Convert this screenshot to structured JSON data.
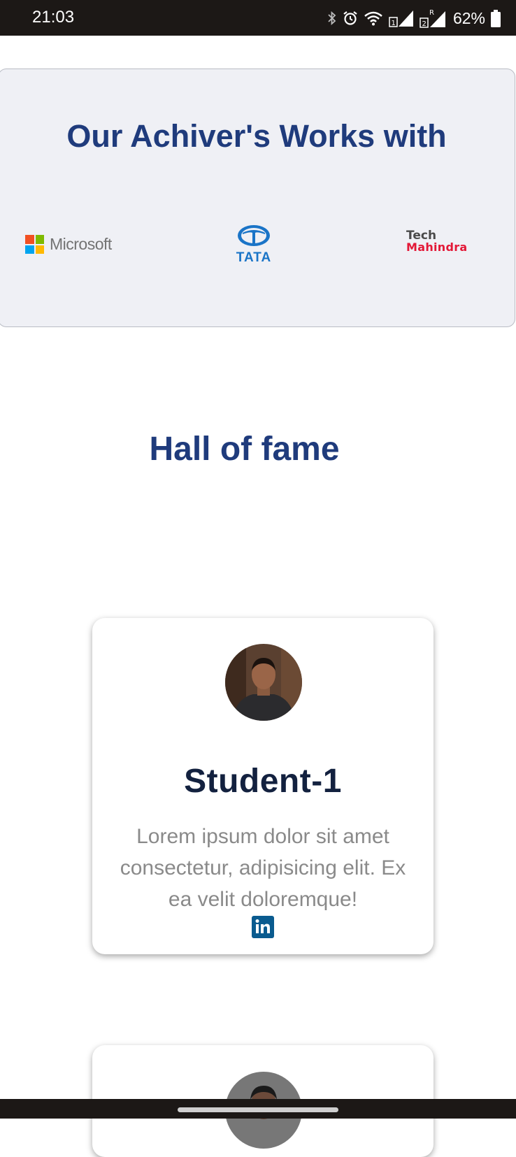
{
  "status_bar": {
    "time": "21:03",
    "battery_percent": "62%",
    "icons": [
      "bluetooth-icon",
      "alarm-icon",
      "wifi-icon",
      "signal-sim1-icon",
      "signal-sim2-roaming-icon",
      "battery-icon"
    ]
  },
  "partners": {
    "title": "Our Achiver's Works with",
    "logos": [
      {
        "name": "Microsoft",
        "text": "Microsoft"
      },
      {
        "name": "TATA",
        "text": "TATA"
      },
      {
        "name": "Tech Mahindra",
        "line1": "Tech",
        "line2": "Mahindra"
      }
    ]
  },
  "hall_of_fame": {
    "title": "Hall of fame",
    "students": [
      {
        "name": "Student-1",
        "description": "Lorem ipsum dolor sit amet consectetur, adipisicing elit. Ex ea velit doloremque!",
        "social_icon": "linkedin-icon"
      }
    ]
  },
  "colors": {
    "heading": "#1f3b7c",
    "name": "#13213f",
    "description": "#8a8a8a",
    "linkedin": "#0a5b8f",
    "partners_bg": "#eff0f5"
  }
}
